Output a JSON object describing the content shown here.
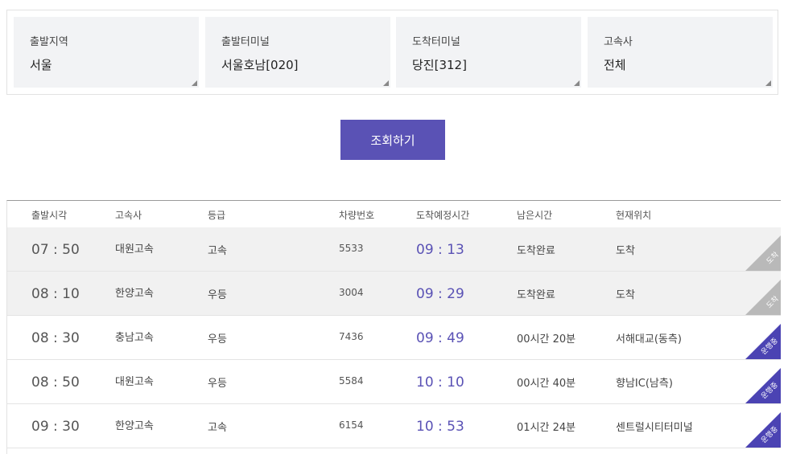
{
  "filters": [
    {
      "label": "출발지역",
      "value": "서울"
    },
    {
      "label": "출발터미널",
      "value": "서울호남[020]"
    },
    {
      "label": "도착터미널",
      "value": "당진[312]"
    },
    {
      "label": "고속사",
      "value": "전체"
    }
  ],
  "search_button": "조회하기",
  "table": {
    "headers": [
      "출발시각",
      "고속사",
      "등급",
      "차량번호",
      "도착예정시간",
      "남은시간",
      "현재위치"
    ],
    "rows": [
      {
        "departure": "07 : 50",
        "company": "대원고속",
        "grade": "고속",
        "bus_no": "5533",
        "arrival": "09 : 13",
        "remaining": "도착완료",
        "location": "도착",
        "status": "도착",
        "status_type": "done"
      },
      {
        "departure": "08 : 10",
        "company": "한양고속",
        "grade": "우등",
        "bus_no": "3004",
        "arrival": "09 : 29",
        "remaining": "도착완료",
        "location": "도착",
        "status": "도착",
        "status_type": "done"
      },
      {
        "departure": "08 : 30",
        "company": "충남고속",
        "grade": "우등",
        "bus_no": "7436",
        "arrival": "09 : 49",
        "remaining": "00시간 20분",
        "location": "서해대교(동측)",
        "status": "운행중",
        "status_type": "running"
      },
      {
        "departure": "08 : 50",
        "company": "대원고속",
        "grade": "우등",
        "bus_no": "5584",
        "arrival": "10 : 10",
        "remaining": "00시간 40분",
        "location": "향남IC(남측)",
        "status": "운행중",
        "status_type": "running"
      },
      {
        "departure": "09 : 30",
        "company": "한양고속",
        "grade": "고속",
        "bus_no": "6154",
        "arrival": "10 : 53",
        "remaining": "01시간 24분",
        "location": "센트럴시티터미널",
        "status": "운행중",
        "status_type": "running"
      }
    ]
  },
  "colors": {
    "accent": "#5a52b5",
    "arrived_badge": "#b9b9b9",
    "running_badge": "#4b43b3"
  }
}
